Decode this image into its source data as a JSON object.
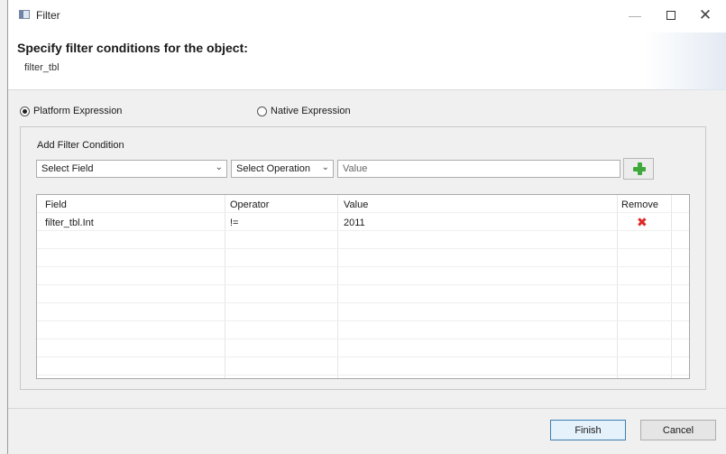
{
  "window": {
    "title": "Filter"
  },
  "header": {
    "title": "Specify filter conditions for the object:",
    "object_name": "filter_tbl"
  },
  "expression": {
    "platform_label": "Platform Expression",
    "native_label": "Native Expression",
    "selected": "Platform Expression"
  },
  "add_condition": {
    "group_label": "Add Filter Condition",
    "field_select": "Select Field",
    "operation_select": "Select Operation",
    "value_placeholder": "Value",
    "add_icon": "green-plus-icon"
  },
  "table": {
    "headers": {
      "field": "Field",
      "operator": "Operator",
      "value": "Value",
      "remove": "Remove"
    },
    "rows": [
      {
        "field": "filter_tbl.Int",
        "operator": "!=",
        "value": "2011",
        "remove_icon": "red-x-icon"
      }
    ]
  },
  "buttons": {
    "finish": "Finish",
    "cancel": "Cancel"
  },
  "colors": {
    "add_icon": "#3ea83a",
    "remove_icon": "#e02a2a",
    "default_button_border": "#3c7fb1"
  }
}
